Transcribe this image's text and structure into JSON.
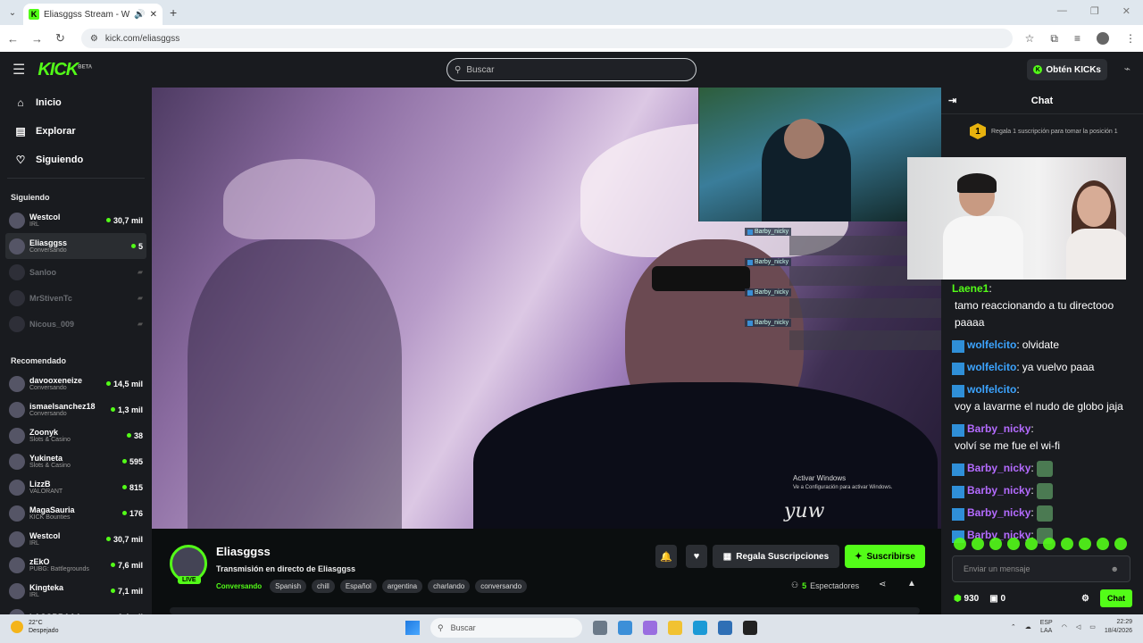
{
  "browser": {
    "tab_title": "Eliasggss Stream - Watch L",
    "tab_favicon": "K",
    "new_tab": "+",
    "url": "kick.com/eliasggss"
  },
  "header": {
    "logo": "KICK",
    "logo_badge": "BETA",
    "search_placeholder": "Buscar",
    "kicks_button": "Obtén KICKs"
  },
  "nav": [
    {
      "icon": "home-icon",
      "glyph": "⌂",
      "label": "Inicio"
    },
    {
      "icon": "browse-icon",
      "glyph": "▤",
      "label": "Explorar"
    },
    {
      "icon": "heart-icon",
      "glyph": "♡",
      "label": "Siguiendo"
    }
  ],
  "following_title": "Siguiendo",
  "following": [
    {
      "name": "Westcol",
      "category": "IRL",
      "viewers": "30,7 mil",
      "online": true
    },
    {
      "name": "Eliasggss",
      "category": "Conversando",
      "viewers": "5",
      "online": true,
      "active": true
    },
    {
      "name": "Sanloo",
      "online": false
    },
    {
      "name": "MrStivenTc",
      "online": false
    },
    {
      "name": "Nicous_009",
      "online": false
    }
  ],
  "recommended_title": "Recomendado",
  "recommended": [
    {
      "name": "davooxeneize",
      "category": "Conversando",
      "viewers": "14,5 mil"
    },
    {
      "name": "ismaelsanchez18",
      "category": "Conversando",
      "viewers": "1,3 mil"
    },
    {
      "name": "Zoonyk",
      "category": "Slots & Casino",
      "viewers": "38"
    },
    {
      "name": "Yukineta",
      "category": "Slots & Casino",
      "viewers": "595"
    },
    {
      "name": "LizzB",
      "category": "VALORANT",
      "viewers": "815"
    },
    {
      "name": "MagaSauria",
      "category": "KICK Bounties",
      "viewers": "176"
    },
    {
      "name": "Westcol",
      "category": "IRL",
      "viewers": "30,7 mil"
    },
    {
      "name": "zEkO",
      "category": "PUBG: Battlegrounds",
      "viewers": "7,6 mil"
    },
    {
      "name": "Kingteka",
      "category": "IRL",
      "viewers": "7,1 mil"
    },
    {
      "name": "LACOBRAAA",
      "category": "",
      "viewers": "6,4 mil"
    }
  ],
  "video": {
    "overlay_user": "Barby_nicky",
    "watermark_title": "Activar Windows",
    "watermark_sub": "Ve a Configuración para activar Windows.",
    "signature": "yuw"
  },
  "stream": {
    "streamer": "Eliasggss",
    "live": "LIVE",
    "title": "Transmisión en directo de Eliasggss",
    "category": "Conversando",
    "tags": [
      "Spanish",
      "chill",
      "Español",
      "argentina",
      "charlando",
      "conversando"
    ],
    "gift_label": "Regala Suscripciones",
    "subscribe_label": "Suscribirse",
    "viewer_count": "5",
    "viewer_label": "Espectadores"
  },
  "chat": {
    "title": "Chat",
    "pinned_rank": "1",
    "pinned_text": "Regala 1 suscripción para tomar la posición 1",
    "messages": [
      {
        "user": "Laene1",
        "color": "#53fc18",
        "badge": false,
        "text": "tamo reaccionando a tu directooo paaaa"
      },
      {
        "user": "wolfelcito",
        "color": "#3ca4ff",
        "badge": true,
        "text": "olvidate"
      },
      {
        "user": "wolfelcito",
        "color": "#3ca4ff",
        "badge": true,
        "text": "ya vuelvo paaa"
      },
      {
        "user": "wolfelcito",
        "color": "#3ca4ff",
        "badge": true,
        "text": "voy a lavarme el nudo de globo jaja"
      },
      {
        "user": "Barby_nicky",
        "color": "#b46bff",
        "badge": true,
        "text": "volví se me fue el wi-fi"
      },
      {
        "user": "Barby_nicky",
        "color": "#b46bff",
        "badge": true,
        "text": "",
        "emote": true
      },
      {
        "user": "Barby_nicky",
        "color": "#b46bff",
        "badge": true,
        "text": "",
        "emote": true
      },
      {
        "user": "Barby_nicky",
        "color": "#b46bff",
        "badge": true,
        "text": "",
        "emote": true
      },
      {
        "user": "Barby_nicky",
        "color": "#b46bff",
        "badge": true,
        "text": "",
        "emote": true
      }
    ],
    "input_placeholder": "Enviar un mensaje",
    "kicks_balance": "930",
    "sub_count": "0",
    "chat_button": "Chat"
  },
  "taskbar": {
    "temp": "22°C",
    "weather": "Despejado",
    "search": "Buscar",
    "lang1": "ESP",
    "lang2": "LAA",
    "time": "22:29",
    "date": "18/4/2026"
  },
  "colors": {
    "accent": "#53fc18",
    "panel": "#191b1f",
    "bg": "#0b0e0f"
  }
}
